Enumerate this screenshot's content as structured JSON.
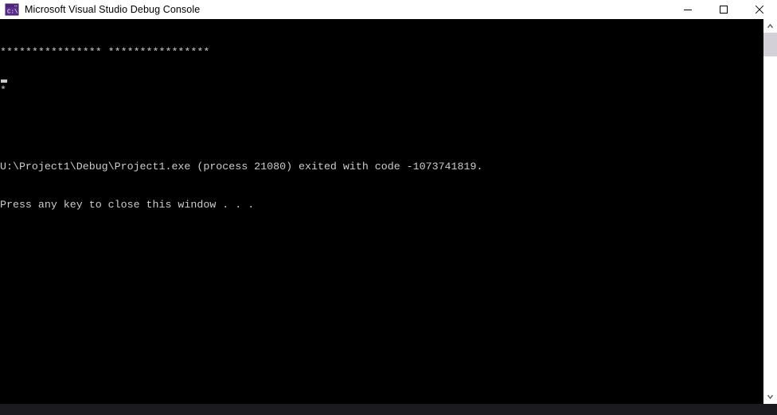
{
  "window": {
    "title": "Microsoft Visual Studio Debug Console",
    "app_icon_name": "console-cmd-icon",
    "icon_label": "C:\\",
    "icon_color": "#5b2d8e",
    "titlebar_bg": "#ffffff",
    "console_bg": "#000000",
    "console_fg": "#cccccc"
  },
  "controls": {
    "minimize_label": "Minimize",
    "maximize_label": "Maximize",
    "close_label": "Close"
  },
  "console": {
    "lines": [
      "**************** ****************",
      "*",
      "",
      "U:\\Project1\\Debug\\Project1.exe (process 21080) exited with code -1073741819.",
      "Press any key to close this window . . ."
    ],
    "line_0": "**************** ****************",
    "line_1": "*",
    "line_2": "",
    "line_3": "U:\\Project1\\Debug\\Project1.exe (process 21080) exited with code -1073741819.",
    "line_4": "Press any key to close this window . . .",
    "cursor_visible": true
  },
  "scrollbar": {
    "up_arrow": "scroll-up-arrow",
    "down_arrow": "scroll-down-arrow",
    "thumb_position": "top"
  }
}
